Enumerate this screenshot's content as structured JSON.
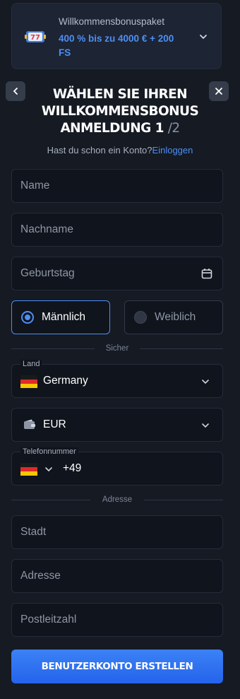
{
  "bonus": {
    "title": "Willkommensbonuspaket",
    "offer": "400 % bis zu 4000 € + 200 FS",
    "icon": "slot-777-icon"
  },
  "header": {
    "title_line1": "WÄHLEN SIE IHREN",
    "title_line2": "WILLKOMMENSBONUS",
    "title_line3": "ANMELDUNG",
    "step_current": "1",
    "step_total": "/2"
  },
  "login": {
    "prompt": "Hast du schon ein Konto?",
    "link": "Einloggen"
  },
  "fields": {
    "name": "Name",
    "surname": "Nachname",
    "birthday": "Geburtstag",
    "city": "Stadt",
    "address": "Adresse",
    "zip": "Postleitzahl"
  },
  "gender": {
    "male": "Männlich",
    "female": "Weiblich",
    "selected": "male"
  },
  "dividers": {
    "secure": "Sicher",
    "address": "Adresse"
  },
  "country": {
    "label": "Land",
    "value": "Germany"
  },
  "currency": {
    "value": "EUR"
  },
  "phone": {
    "label": "Telefonnummer",
    "code": "+49"
  },
  "submit": "BENUTZERKONTO ERSTELLEN",
  "colors": {
    "accent": "#4d8ff5",
    "background": "#151a23",
    "button": "#2f74f0"
  }
}
